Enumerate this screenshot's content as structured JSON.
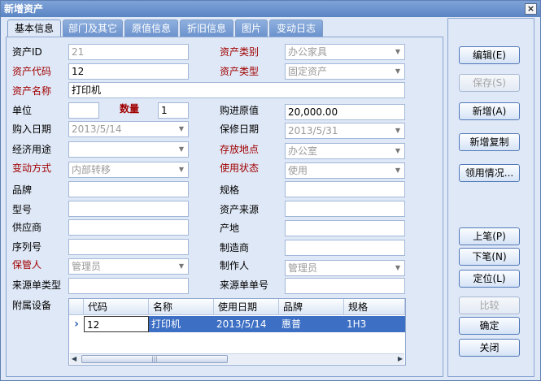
{
  "window": {
    "title": "新增资产",
    "close_icon": "×"
  },
  "tabs": [
    "基本信息",
    "部门及其它",
    "原值信息",
    "折旧信息",
    "图片",
    "变动日志"
  ],
  "form": {
    "asset_id": {
      "label": "资产ID",
      "value": "21"
    },
    "asset_category": {
      "label": "资产类别",
      "value": "办公家具"
    },
    "asset_code": {
      "label": "资产代码",
      "value": "12"
    },
    "asset_type": {
      "label": "资产类型",
      "value": "固定资产"
    },
    "asset_name": {
      "label": "资产名称",
      "value": "打印机"
    },
    "unit": {
      "label": "单位",
      "value": ""
    },
    "quantity": {
      "label": "数量",
      "value": "1"
    },
    "purchase_value": {
      "label": "购进原值",
      "value": "20,000.00"
    },
    "purchase_date": {
      "label": "购入日期",
      "value": "2013/5/14"
    },
    "warranty_date": {
      "label": "保修日期",
      "value": "2013/5/31"
    },
    "economic_use": {
      "label": "经济用途",
      "value": ""
    },
    "location": {
      "label": "存放地点",
      "value": "办公室"
    },
    "change_method": {
      "label": "变动方式",
      "value": "内部转移"
    },
    "use_status": {
      "label": "使用状态",
      "value": "使用"
    },
    "brand": {
      "label": "品牌",
      "value": ""
    },
    "spec": {
      "label": "规格",
      "value": ""
    },
    "model": {
      "label": "型号",
      "value": ""
    },
    "asset_source": {
      "label": "资产来源",
      "value": ""
    },
    "supplier": {
      "label": "供应商",
      "value": ""
    },
    "origin": {
      "label": "产地",
      "value": ""
    },
    "serial": {
      "label": "序列号",
      "value": ""
    },
    "manufacturer": {
      "label": "制造商",
      "value": ""
    },
    "custodian": {
      "label": "保管人",
      "value": "管理员"
    },
    "creator": {
      "label": "制作人",
      "value": "管理员"
    },
    "source_doc_type": {
      "label": "来源单类型",
      "value": ""
    },
    "source_doc_no": {
      "label": "来源单单号",
      "value": ""
    },
    "attached_label": "附属设备"
  },
  "grid": {
    "columns": [
      "代码",
      "名称",
      "使用日期",
      "品牌",
      "规格"
    ],
    "row": [
      "12",
      "打印机",
      "2013/5/14",
      "惠普",
      "1H3"
    ],
    "row_marker": "›"
  },
  "buttons": {
    "edit": "编辑(E)",
    "save": "保存(S)",
    "add": "新增(A)",
    "add_copy": "新增复制",
    "usage": "领用情况...",
    "prev": "上笔(P)",
    "next": "下笔(N)",
    "locate": "定位(L)",
    "compare": "比较",
    "ok": "确定",
    "close": "关闭"
  },
  "scroll": {
    "left": "◀",
    "right": "▶",
    "thumb": "|||"
  }
}
